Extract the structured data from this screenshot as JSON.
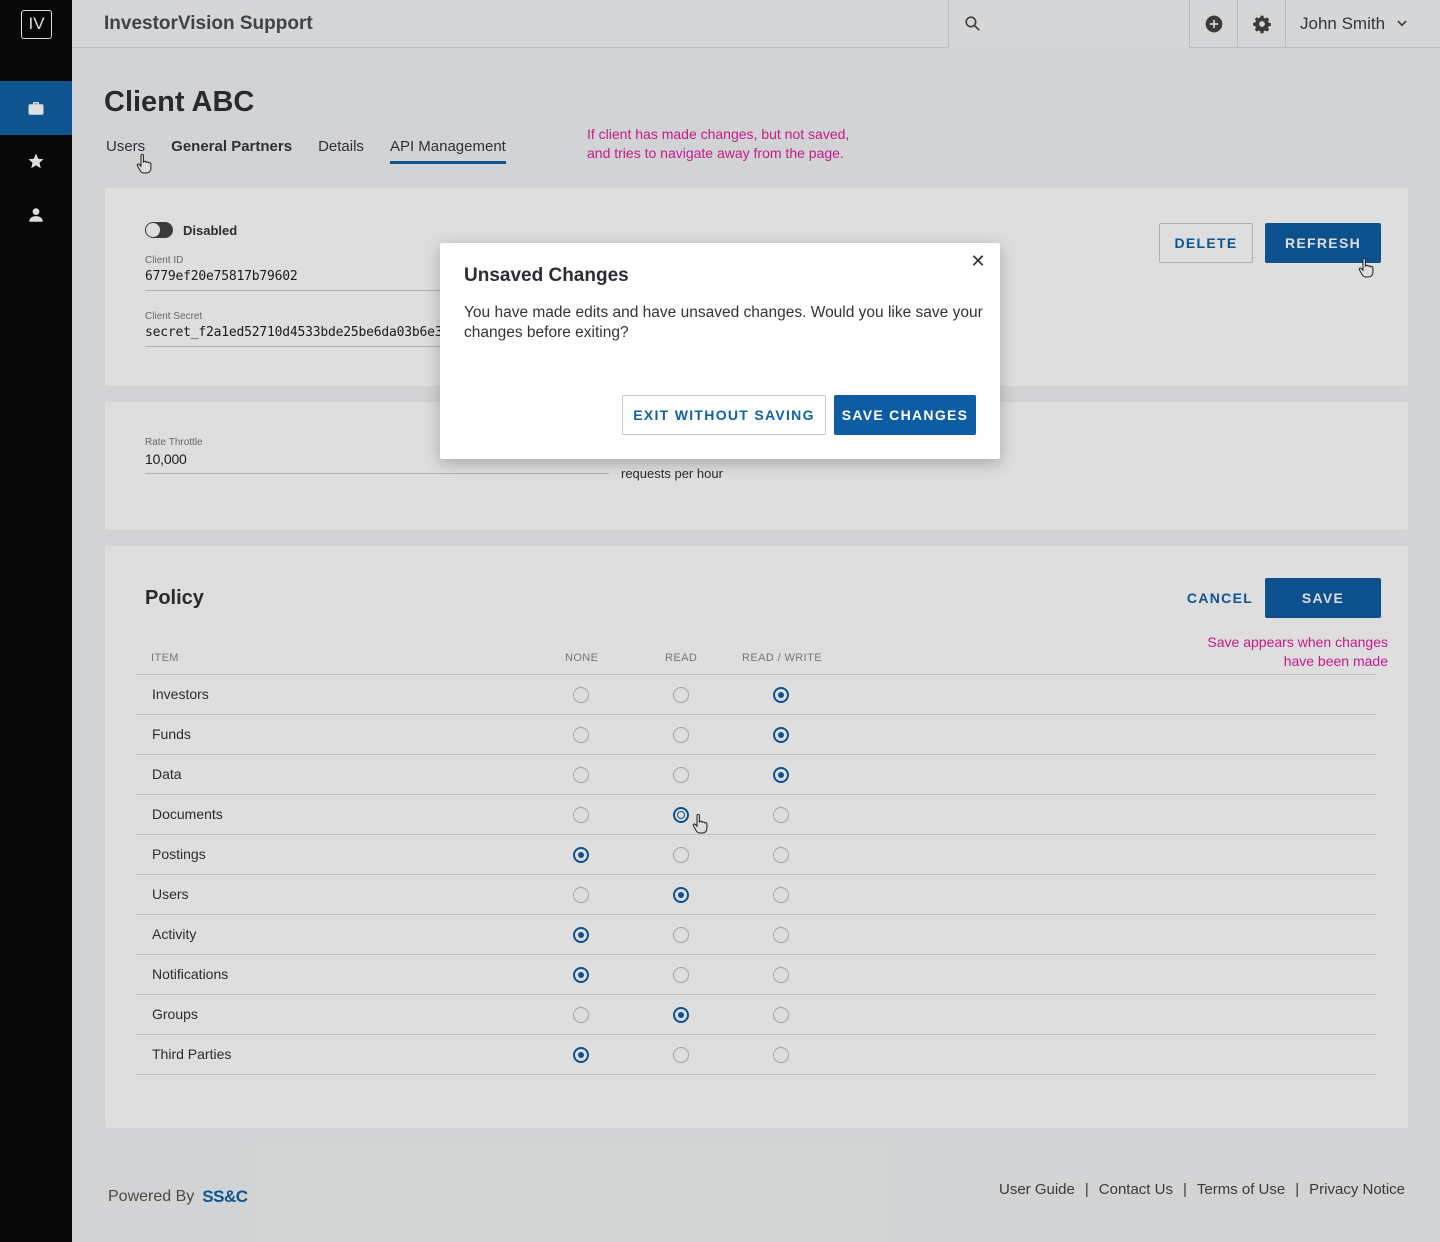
{
  "sidebar": {
    "logo": "IV",
    "items": [
      {
        "icon": "briefcase-icon",
        "active": true
      },
      {
        "icon": "star-icon",
        "active": false
      },
      {
        "icon": "person-icon",
        "active": false
      }
    ]
  },
  "topbar": {
    "title": "InvestorVision Support",
    "search_placeholder": "",
    "user_name": "John Smith"
  },
  "page": {
    "title": "Client ABC",
    "tabs": [
      {
        "label": "Users"
      },
      {
        "label": "General Partners"
      },
      {
        "label": "Details"
      },
      {
        "label": "API Management"
      }
    ],
    "note_top": "If client has made changes, but not saved,\nand tries to navigate away from the page."
  },
  "credentials": {
    "toggle_label": "Disabled",
    "client_id_label": "Client ID",
    "client_id": "6779ef20e75817b79602",
    "client_secret_label": "Client Secret",
    "client_secret": "secret_f2a1ed52710d4533bde25be6da03b6e3",
    "delete_label": "DELETE",
    "refresh_label": "REFRESH"
  },
  "throttle": {
    "label": "Rate Throttle",
    "value": "10,000",
    "suffix": "requests per hour"
  },
  "policy": {
    "title": "Policy",
    "cancel_label": "CANCEL",
    "save_label": "SAVE",
    "note": "Save appears when changes\nhave been made",
    "columns": [
      "ITEM",
      "NONE",
      "READ",
      "READ / WRITE"
    ],
    "rows": [
      {
        "name": "Investors",
        "value": "READ / WRITE"
      },
      {
        "name": "Funds",
        "value": "READ / WRITE"
      },
      {
        "name": "Data",
        "value": "READ / WRITE"
      },
      {
        "name": "Documents",
        "value": "READ"
      },
      {
        "name": "Postings",
        "value": "NONE"
      },
      {
        "name": "Users",
        "value": "READ"
      },
      {
        "name": "Activity",
        "value": "NONE"
      },
      {
        "name": "Notifications",
        "value": "NONE"
      },
      {
        "name": "Groups",
        "value": "READ"
      },
      {
        "name": "Third Parties",
        "value": "NONE"
      }
    ]
  },
  "footer": {
    "powered_by": "Powered By",
    "brand": "SS&C",
    "links": [
      "User Guide",
      "Contact Us",
      "Terms of Use",
      "Privacy Notice"
    ]
  },
  "modal": {
    "title": "Unsaved Changes",
    "body": "You have made edits and have unsaved changes. Would you like save your changes before exiting?",
    "exit_label": "EXIT WITHOUT SAVING",
    "save_label": "SAVE CHANGES"
  },
  "colors": {
    "primary": "#0e5ca3",
    "annotation": "#e020a0",
    "sidebar_bg": "#0a0a0a"
  }
}
